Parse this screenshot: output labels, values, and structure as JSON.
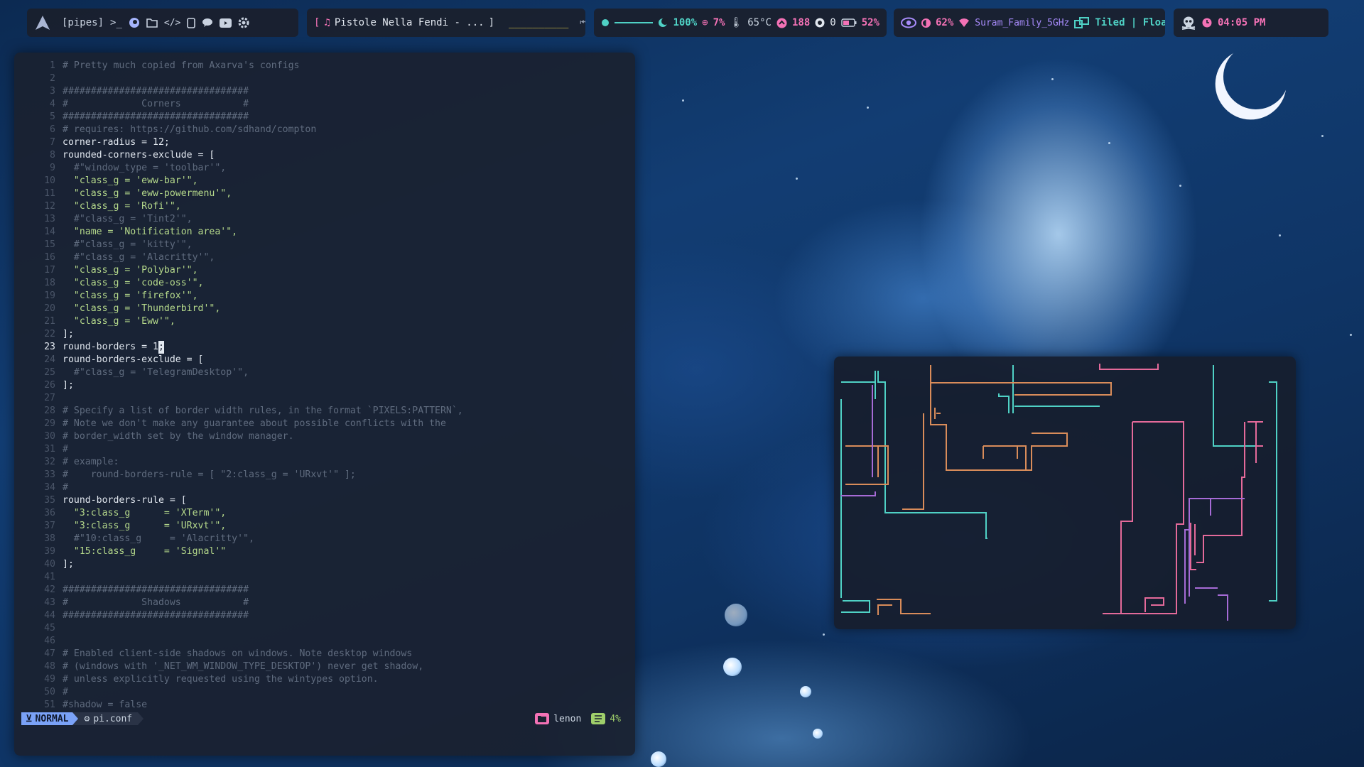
{
  "topbar": {
    "launcher_icon": "arch-logo-icon",
    "workspace_label": "[pipes]",
    "workspace_icons": [
      "terminal-icon",
      "firefox-icon",
      "folder-icon",
      "code-icon",
      "file-icon",
      "chat-icon",
      "youtube-icon",
      "gear-icon"
    ],
    "music": {
      "bracket_open": "[",
      "title": "Pistole Nella Fendi - ...",
      "bracket_close": "]",
      "progress_text": "__________"
    },
    "system": {
      "volume": "100%",
      "volume_level": 1.0,
      "cpu": "7%",
      "temperature": "65°C",
      "updates": "188",
      "github": "0",
      "battery": "52%"
    },
    "network": {
      "brightness": "62%",
      "wifi": "Suram_Family_5GHz",
      "layout": "Tiled | Float"
    },
    "clock": {
      "time": "04:05 PM"
    },
    "colors": {
      "teal": "#4fd1c5",
      "pink": "#f472b6",
      "yellow": "#e5d34b",
      "purple": "#a78bfa"
    }
  },
  "editor": {
    "current_line": 23,
    "lines": [
      {
        "n": "1",
        "t": "# Pretty much copied from Axarva's configs",
        "k": "cm"
      },
      {
        "n": "2",
        "t": "",
        "k": "tx"
      },
      {
        "n": "3",
        "t": "#################################",
        "k": "cm"
      },
      {
        "n": "4",
        "t": "#             Corners           #",
        "k": "cm"
      },
      {
        "n": "5",
        "t": "#################################",
        "k": "cm"
      },
      {
        "n": "6",
        "t": "# requires: https://github.com/sdhand/compton",
        "k": "cm"
      },
      {
        "n": "7",
        "t": "corner-radius = 12;",
        "k": "tx"
      },
      {
        "n": "8",
        "t": "rounded-corners-exclude = [",
        "k": "tx"
      },
      {
        "n": "9",
        "t": "  #\"window_type = 'toolbar'\",",
        "k": "cm"
      },
      {
        "n": "10",
        "t": "  \"class_g = 'eww-bar'\",",
        "k": "st"
      },
      {
        "n": "11",
        "t": "  \"class_g = 'eww-powermenu'\",",
        "k": "st"
      },
      {
        "n": "12",
        "t": "  \"class_g = 'Rofi'\",",
        "k": "st"
      },
      {
        "n": "13",
        "t": "  #\"class_g = 'Tint2'\",",
        "k": "cm"
      },
      {
        "n": "14",
        "t": "  \"name = 'Notification area'\",",
        "k": "st"
      },
      {
        "n": "15",
        "t": "  #\"class_g = 'kitty'\",",
        "k": "cm"
      },
      {
        "n": "16",
        "t": "  #\"class_g = 'Alacritty'\",",
        "k": "cm"
      },
      {
        "n": "17",
        "t": "  \"class_g = 'Polybar'\",",
        "k": "st"
      },
      {
        "n": "18",
        "t": "  \"class_g = 'code-oss'\",",
        "k": "st"
      },
      {
        "n": "19",
        "t": "  \"class_g = 'firefox'\",",
        "k": "st"
      },
      {
        "n": "20",
        "t": "  \"class_g = 'Thunderbird'\",",
        "k": "st"
      },
      {
        "n": "21",
        "t": "  \"class_g = 'Eww'\",",
        "k": "st"
      },
      {
        "n": "22",
        "t": "];",
        "k": "tx"
      },
      {
        "n": "23",
        "t": "round-borders = 1",
        "k": "tx",
        "cursor": ";"
      },
      {
        "n": "24",
        "t": "round-borders-exclude = [",
        "k": "tx"
      },
      {
        "n": "25",
        "t": "  #\"class_g = 'TelegramDesktop'\",",
        "k": "cm"
      },
      {
        "n": "26",
        "t": "];",
        "k": "tx"
      },
      {
        "n": "27",
        "t": "",
        "k": "tx"
      },
      {
        "n": "28",
        "t": "# Specify a list of border width rules, in the format `PIXELS:PATTERN`,",
        "k": "cm"
      },
      {
        "n": "29",
        "t": "# Note we don't make any guarantee about possible conflicts with the",
        "k": "cm"
      },
      {
        "n": "30",
        "t": "# border_width set by the window manager.",
        "k": "cm"
      },
      {
        "n": "31",
        "t": "#",
        "k": "cm"
      },
      {
        "n": "32",
        "t": "# example:",
        "k": "cm"
      },
      {
        "n": "33",
        "t": "#    round-borders-rule = [ \"2:class_g = 'URxvt'\" ];",
        "k": "cm"
      },
      {
        "n": "34",
        "t": "#",
        "k": "cm"
      },
      {
        "n": "35",
        "t": "round-borders-rule = [",
        "k": "tx"
      },
      {
        "n": "36",
        "t": "  \"3:class_g      = 'XTerm'\",",
        "k": "st"
      },
      {
        "n": "37",
        "t": "  \"3:class_g      = 'URxvt'\",",
        "k": "st"
      },
      {
        "n": "38",
        "t": "  #\"10:class_g     = 'Alacritty'\",",
        "k": "cm"
      },
      {
        "n": "39",
        "t": "  \"15:class_g     = 'Signal'\"",
        "k": "st"
      },
      {
        "n": "40",
        "t": "];",
        "k": "tx"
      },
      {
        "n": "41",
        "t": "",
        "k": "tx"
      },
      {
        "n": "42",
        "t": "#################################",
        "k": "cm"
      },
      {
        "n": "43",
        "t": "#             Shadows           #",
        "k": "cm"
      },
      {
        "n": "44",
        "t": "#################################",
        "k": "cm"
      },
      {
        "n": "45",
        "t": "",
        "k": "tx"
      },
      {
        "n": "46",
        "t": "",
        "k": "tx"
      },
      {
        "n": "47",
        "t": "# Enabled client-side shadows on windows. Note desktop windows",
        "k": "cm"
      },
      {
        "n": "48",
        "t": "# (windows with '_NET_WM_WINDOW_TYPE_DESKTOP') never get shadow,",
        "k": "cm"
      },
      {
        "n": "49",
        "t": "# unless explicitly requested using the wintypes option.",
        "k": "cm"
      },
      {
        "n": "50",
        "t": "#",
        "k": "cm"
      },
      {
        "n": "51",
        "t": "#shadow = false",
        "k": "cm"
      }
    ],
    "statusline": {
      "mode": "NORMAL",
      "file": "pi.conf",
      "user": "lenon",
      "percent": "4%"
    }
  }
}
